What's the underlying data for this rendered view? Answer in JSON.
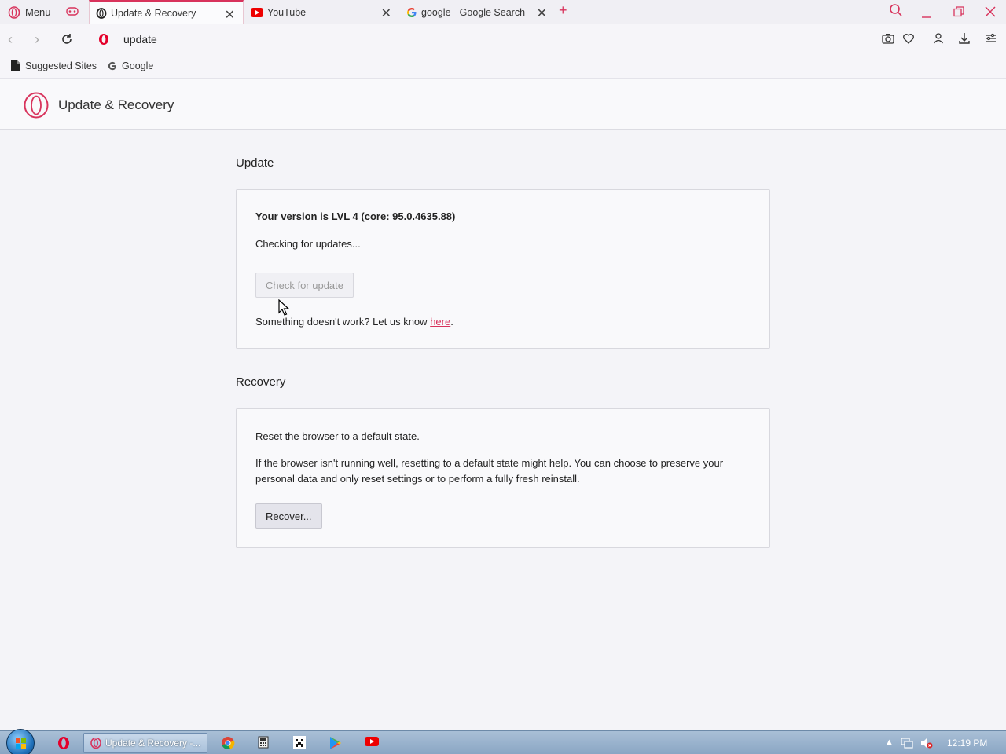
{
  "browser": {
    "menu_label": "Menu",
    "tabs": [
      {
        "title": "Update & Recovery",
        "active": true
      },
      {
        "title": "YouTube",
        "active": false
      },
      {
        "title": "google - Google Search",
        "active": false
      }
    ],
    "new_tab_symbol": "+",
    "address": "update",
    "bookmarks": [
      "Suggested Sites",
      "Google"
    ],
    "accent_color": "#d8335c"
  },
  "page": {
    "header_title": "Update & Recovery",
    "update": {
      "section_title": "Update",
      "version_label": "Your version is",
      "version_value": "LVL 4 (core: 95.0.4635.88)",
      "status": "Checking for updates...",
      "check_button": "Check for update",
      "feedback_text": "Something doesn't work? Let us know",
      "feedback_link": "here",
      "feedback_end": "."
    },
    "recovery": {
      "section_title": "Recovery",
      "line1": "Reset the browser to a default state.",
      "line2": "If the browser isn't running well, resetting to a default state might help. You can choose to preserve your personal data and only reset settings or to perform a fully fresh reinstall.",
      "recover_button": "Recover..."
    }
  },
  "taskbar": {
    "active_task": "Update & Recovery -...",
    "clock": "12:19 PM"
  }
}
